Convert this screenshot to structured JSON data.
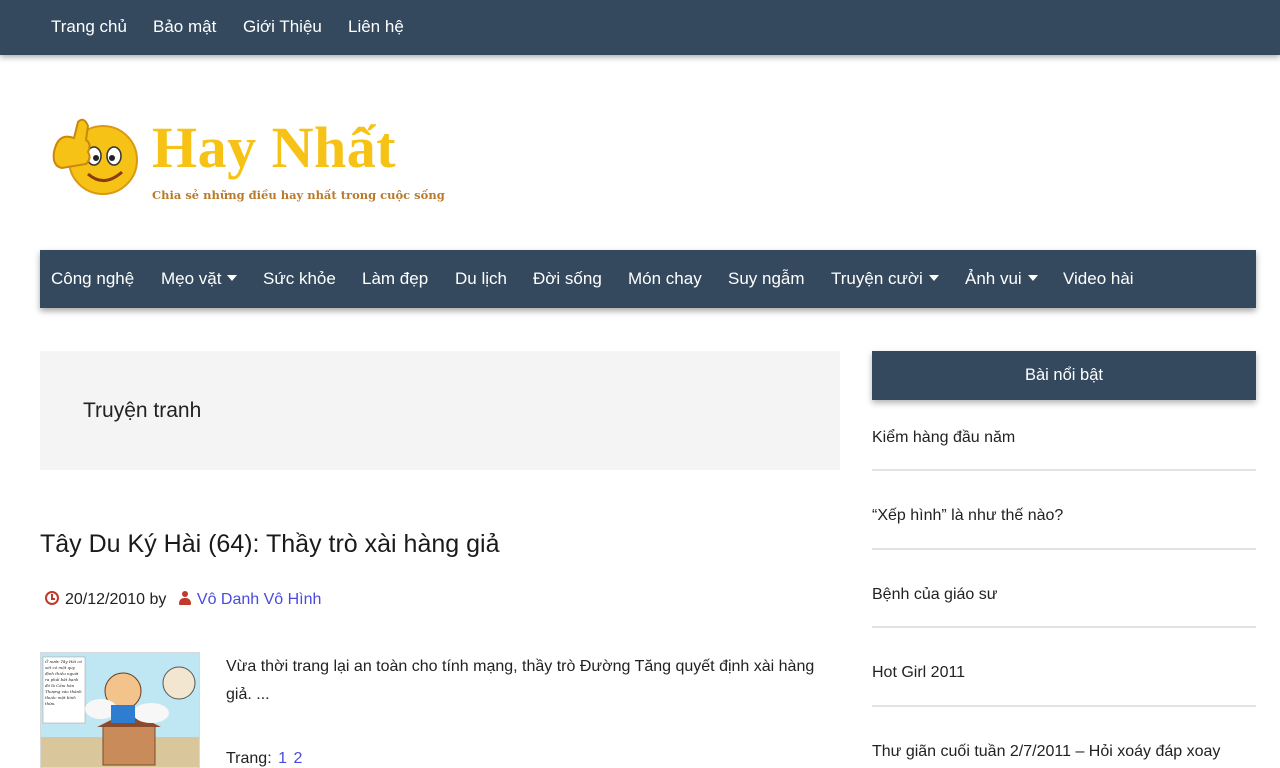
{
  "top_nav": [
    "Trang chủ",
    "Bảo mật",
    "Giới Thiệu",
    "Liên hệ"
  ],
  "logo": {
    "title": "Hay Nhất",
    "tagline": "Chia sẻ những điều hay nhất trong cuộc sống"
  },
  "main_nav": [
    {
      "label": "Công nghệ",
      "dropdown": false
    },
    {
      "label": "Mẹo vặt",
      "dropdown": true
    },
    {
      "label": "Sức khỏe",
      "dropdown": false
    },
    {
      "label": "Làm đẹp",
      "dropdown": false
    },
    {
      "label": "Du lịch",
      "dropdown": false
    },
    {
      "label": "Đời sống",
      "dropdown": false
    },
    {
      "label": "Món chay",
      "dropdown": false
    },
    {
      "label": "Suy ngẫm",
      "dropdown": false
    },
    {
      "label": "Truyện cười",
      "dropdown": true
    },
    {
      "label": "Ảnh vui",
      "dropdown": true
    },
    {
      "label": "Video hài",
      "dropdown": false
    }
  ],
  "archive": {
    "title": "Truyện tranh"
  },
  "post": {
    "title": "Tây Du Ký Hài (64): Thầy trò xài hàng giả",
    "date": "20/12/2010",
    "by_label": "by",
    "author": "Vô Danh Vô Hình",
    "excerpt": "Vừa thời trang lại an toàn cho tính mạng, thầy trò Đường Tăng quyết định xài hàng giả. ...",
    "pages_label": "Trang:",
    "pages": [
      "1",
      "2"
    ],
    "thumbnail_caption": "Ở nước Tây Hải có xét có một quy định thiếu nguời ra phải bắt bạnh đó là Cảm hàn Thượng vào thành thuốc mặt bình thừa."
  },
  "sidebar": {
    "heading": "Bài nổi bật",
    "items": [
      "Kiểm hàng đầu năm",
      "“Xếp hình” là như thế nào?",
      "Bệnh của giáo sư",
      "Hot Girl 2011",
      "Thư giãn cuối tuần 2/7/2011 – Hỏi xoáy đáp xoay"
    ]
  },
  "colors": {
    "nav_bg": "#34495e",
    "logo_yellow": "#f6c215",
    "link_blue": "#4a4ae0",
    "icon_red": "#c0392b",
    "archive_bg": "#f4f4f4"
  }
}
